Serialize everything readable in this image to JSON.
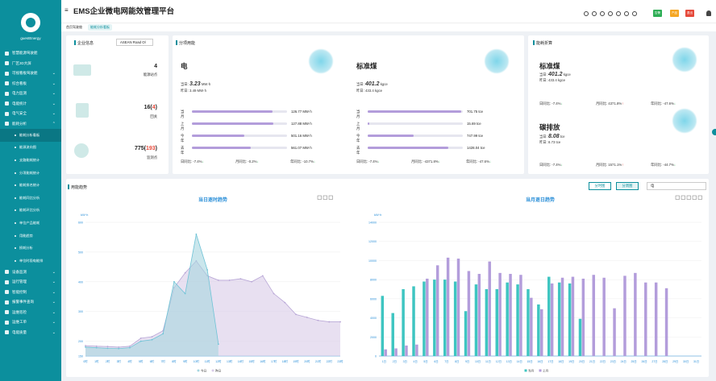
{
  "app": {
    "title": "EMS企业微电网能效管理平台",
    "user": "guestEnergy"
  },
  "breadcrumb": {
    "home": "首页驾驶舱",
    "current": "能耗分析看板"
  },
  "header": {
    "badges": [
      {
        "label": "告警",
        "color": "#2eae55"
      },
      {
        "label": "产品",
        "color": "#f5a623"
      },
      {
        "label": "退出",
        "color": "#e64a3b"
      }
    ]
  },
  "sidebar": {
    "items": [
      {
        "label": "智慧能源驾驶舱",
        "type": "top"
      },
      {
        "label": "厂区3D大屏",
        "type": "top"
      },
      {
        "label": "可视看板驾驶舱",
        "type": "top",
        "chev": "⌄"
      },
      {
        "label": "综合看板",
        "type": "top",
        "chev": "⌄"
      },
      {
        "label": "电力监测",
        "type": "top",
        "chev": "⌄"
      },
      {
        "label": "电能统计",
        "type": "top",
        "chev": "⌄"
      },
      {
        "label": "电气安全",
        "type": "top",
        "chev": "⌄"
      },
      {
        "label": "能耗分析",
        "type": "top",
        "chev": "⌃"
      },
      {
        "label": "能耗分析看板",
        "type": "sub",
        "active": true
      },
      {
        "label": "能源流向图",
        "type": "sub"
      },
      {
        "label": "支路能耗统计",
        "type": "sub"
      },
      {
        "label": "分项能耗统计",
        "type": "sub"
      },
      {
        "label": "能耗排名统计",
        "type": "sub"
      },
      {
        "label": "能耗同比分析",
        "type": "sub"
      },
      {
        "label": "能耗环比分析",
        "type": "sub"
      },
      {
        "label": "单位产品能耗",
        "type": "sub"
      },
      {
        "label": "用能趋势",
        "type": "sub"
      },
      {
        "label": "损耗分析",
        "type": "sub"
      },
      {
        "label": "单位时段电能排",
        "type": "sub"
      },
      {
        "label": "设备监测",
        "type": "top",
        "chev": "⌄"
      },
      {
        "label": "运行管理",
        "type": "top",
        "chev": "⌄"
      },
      {
        "label": "智能控制",
        "type": "top",
        "chev": "⌄"
      },
      {
        "label": "报警事件查询",
        "type": "top",
        "chev": "⌄"
      },
      {
        "label": "运维巡检",
        "type": "top",
        "chev": "⌄"
      },
      {
        "label": "运维工单",
        "type": "top",
        "chev": "⌄"
      },
      {
        "label": "电能质量",
        "type": "top",
        "chev": "⌄"
      }
    ]
  },
  "company": {
    "title": "企业信息",
    "select": "ASEAN Road Ol",
    "stats": [
      {
        "value": "4",
        "label": "能源站点"
      },
      {
        "value": "16",
        "highlight": "4",
        "label": "回关"
      },
      {
        "value": "775",
        "highlight": "193",
        "label": "监测点"
      }
    ]
  },
  "subitem": {
    "title": "分项用能",
    "cards": [
      {
        "name": "电",
        "today_label": "当日:",
        "today_value": "3.23",
        "today_unit": "MW·h",
        "yesterday": "昨日: 3.49 MW·h",
        "rows": [
          {
            "label": "当月",
            "value": "126.77 MW·h",
            "frac": 0.85
          },
          {
            "label": "上月",
            "value": "127.88 MW·h",
            "frac": 0.86
          },
          {
            "label": "今年",
            "value": "501.16 MW·h",
            "frac": 0.55
          },
          {
            "label": "去年",
            "value": "561.07 MW·h",
            "frac": 0.62
          }
        ],
        "yoy": "日同比: -7.4%",
        "mom": "月同比: -0.2%",
        "ann": "年同比: -10.7%"
      },
      {
        "name": "标准煤",
        "today_label": "当日:",
        "today_value": "401.2",
        "today_unit": "kgce",
        "yesterday": "昨日: 433.4 kgce",
        "rows": [
          {
            "label": "当月",
            "value": "701.75 tce",
            "frac": 0.98
          },
          {
            "label": "上月",
            "value": "15.69 tce",
            "frac": 0.02
          },
          {
            "label": "今年",
            "value": "747.99 tce",
            "frac": 0.48
          },
          {
            "label": "去年",
            "value": "1428.04 tce",
            "frac": 0.85
          }
        ],
        "yoy": "日同比: -7.4%",
        "mom": "月同比: -4371.8%",
        "ann": "年同比: -47.6%"
      }
    ]
  },
  "conversion": {
    "title": "能耗折算",
    "coal": {
      "name": "标准煤",
      "today_label": "当日:",
      "today_value": "401.2",
      "today_unit": "kgce",
      "yesterday": "昨日: 433.4 kgce",
      "yoy": "日同比: -7.4%",
      "mom": "月同比: 4371.8%",
      "ann": "年同比: -47.6%"
    },
    "carbon": {
      "name": "碳排放",
      "today_label": "当日:",
      "today_value": "8.08",
      "today_unit": "tce",
      "yesterday": "昨日: 8.73 tce",
      "yoy": "日同比: -7.4%",
      "mom": "月同比: 1571.1%",
      "ann": "年同比: -44.7%"
    }
  },
  "trend": {
    "title": "用能趋势",
    "buttons": [
      "分时图",
      "分周图"
    ],
    "select": "电",
    "left_title": "当日逐时趋势",
    "right_title": "当月逐日趋势",
    "left_unit": "kW·h",
    "right_unit": "kW·h"
  },
  "chart_data": [
    {
      "type": "area",
      "title": "当日逐时趋势",
      "ylabel": "kW·h",
      "ylim": [
        150,
        600
      ],
      "x": [
        "0时",
        "1时",
        "2时",
        "3时",
        "4时",
        "5时",
        "6时",
        "7时",
        "8时",
        "9时",
        "10时",
        "11时",
        "12时",
        "13时",
        "14时",
        "15时",
        "16时",
        "17时",
        "18时",
        "19时",
        "20时",
        "21时",
        "22时",
        "23时"
      ],
      "series": [
        {
          "name": "今日",
          "color": "#a6d6e0",
          "values": [
            180,
            178,
            176,
            175,
            178,
            200,
            205,
            225,
            400,
            360,
            560,
            440,
            190,
            null,
            null,
            null,
            null,
            null,
            null,
            null,
            null,
            null,
            null,
            null
          ]
        },
        {
          "name": "昨日",
          "color": "#d8cbe8",
          "values": [
            185,
            183,
            182,
            180,
            183,
            210,
            215,
            235,
            380,
            430,
            470,
            420,
            405,
            405,
            410,
            400,
            420,
            360,
            330,
            290,
            280,
            270,
            265,
            265
          ]
        }
      ]
    },
    {
      "type": "bar",
      "title": "当月逐日趋势",
      "ylabel": "kW·h",
      "ylim": [
        0,
        14000
      ],
      "x": [
        "1日",
        "2日",
        "3日",
        "4日",
        "5日",
        "6日",
        "7日",
        "8日",
        "9日",
        "10日",
        "11日",
        "12日",
        "13日",
        "14日",
        "15日",
        "16日",
        "17日",
        "18日",
        "19日",
        "20日",
        "21日",
        "22日",
        "23日",
        "24日",
        "25日",
        "26日",
        "27日",
        "28日",
        "29日",
        "30日",
        "31日"
      ],
      "series": [
        {
          "name": "当月",
          "color": "#3ec5c1",
          "values": [
            6300,
            4500,
            7000,
            7300,
            7800,
            8000,
            8000,
            7800,
            4700,
            7500,
            7000,
            7000,
            7700,
            7500,
            7000,
            5400,
            8300,
            7700,
            7600,
            3900,
            null,
            null,
            null,
            null,
            null,
            null,
            null,
            null,
            null,
            null,
            null
          ]
        },
        {
          "name": "上月",
          "color": "#b39ddb",
          "values": [
            700,
            800,
            1100,
            1200,
            8100,
            9500,
            10300,
            10200,
            8900,
            8600,
            9900,
            8700,
            8600,
            8500,
            6100,
            4900,
            7600,
            8200,
            8300,
            8100,
            8500,
            8200,
            5000,
            8400,
            8700,
            7700,
            7700,
            7100,
            null,
            null,
            null
          ]
        }
      ]
    }
  ]
}
